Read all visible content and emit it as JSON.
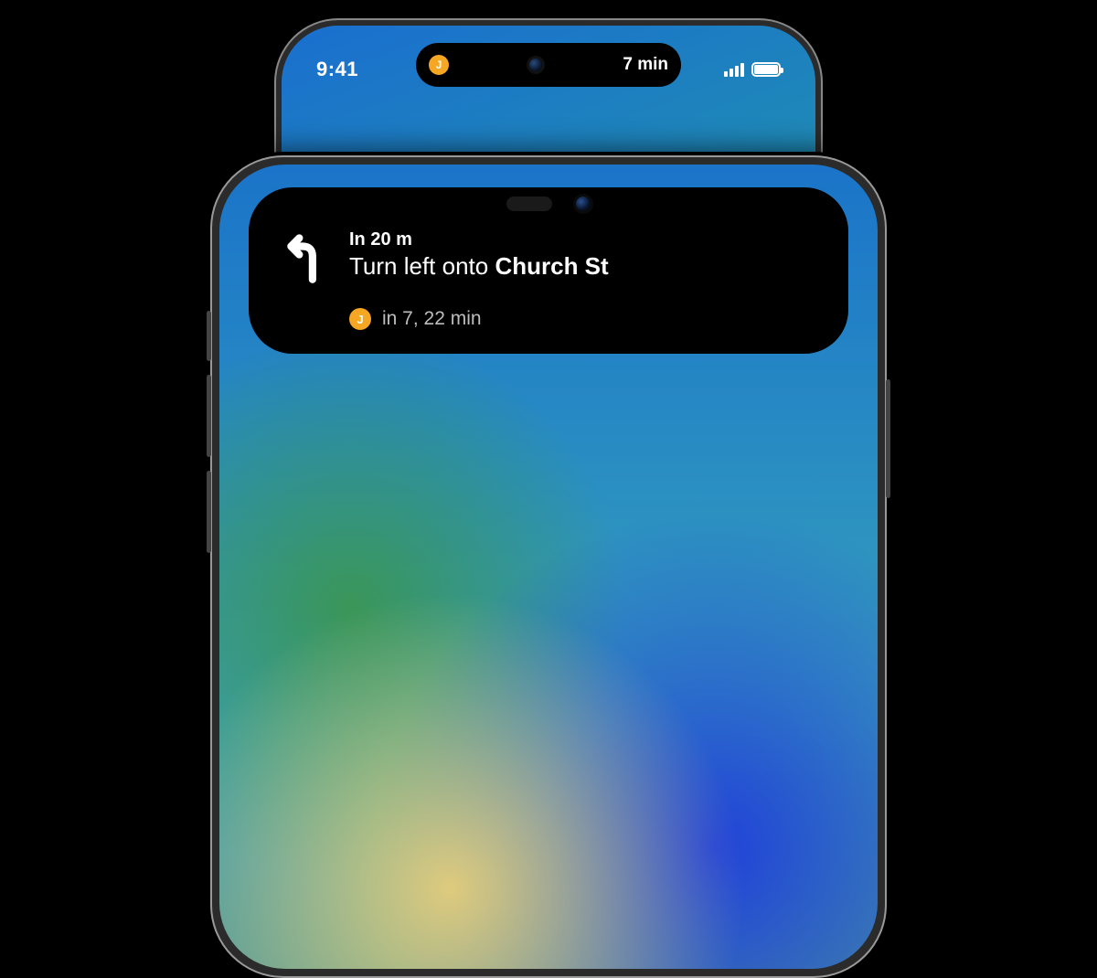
{
  "status": {
    "time": "9:41"
  },
  "island_compact": {
    "badge_letter": "J",
    "eta": "7 min"
  },
  "island_expanded": {
    "distance": "In 20 m",
    "instruction_prefix": "Turn left onto ",
    "instruction_bold": "Church St",
    "eta_badge_letter": "J",
    "eta_text": "in 7, 22 min"
  }
}
